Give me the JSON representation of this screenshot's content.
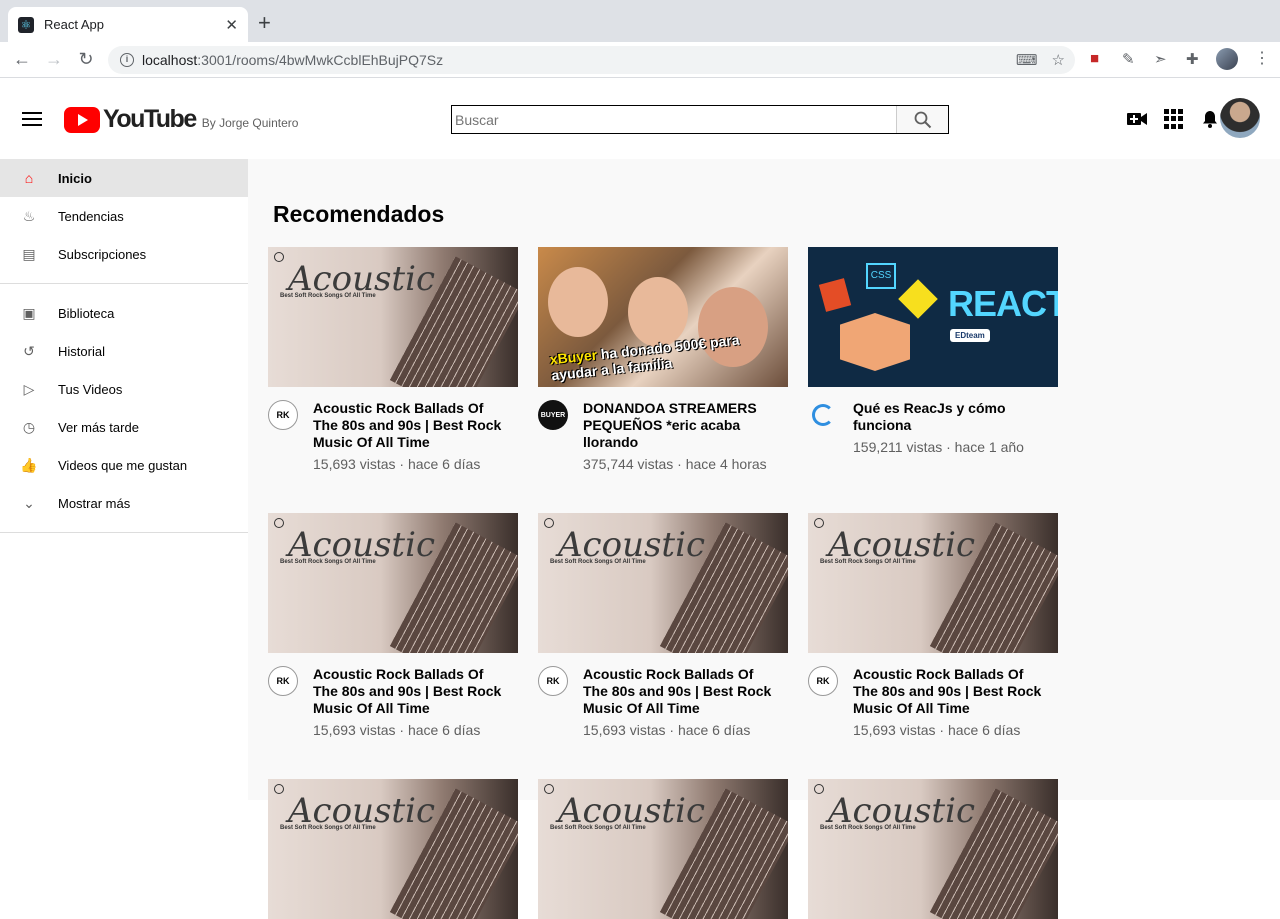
{
  "browser": {
    "tab_title": "React App",
    "tab_close": "✕",
    "new_tab": "+",
    "url_host": "localhost",
    "url_path": ":3001/rooms/4bwMwkCcblEhBujPQ7Sz"
  },
  "header": {
    "logo_word": "YouTube",
    "logo_by": "By Jorge Quintero",
    "search_placeholder": "Buscar"
  },
  "sidebar": {
    "primary": [
      {
        "label": "Inicio",
        "icon": "home-icon",
        "glyph": "⌂"
      },
      {
        "label": "Tendencias",
        "icon": "fire-icon",
        "glyph": "♨"
      },
      {
        "label": "Subscripciones",
        "icon": "subscriptions-icon",
        "glyph": "▤"
      }
    ],
    "secondary": [
      {
        "label": "Biblioteca",
        "icon": "library-icon",
        "glyph": "▣"
      },
      {
        "label": "Historial",
        "icon": "history-icon",
        "glyph": "↺"
      },
      {
        "label": "Tus Videos",
        "icon": "your-videos-icon",
        "glyph": "▷"
      },
      {
        "label": "Ver más tarde",
        "icon": "watch-later-icon",
        "glyph": "◷"
      },
      {
        "label": "Videos que me gustan",
        "icon": "like-icon",
        "glyph": "👍"
      },
      {
        "label": "Mostrar más",
        "icon": "chevron-down-icon",
        "glyph": "⌄"
      }
    ]
  },
  "main": {
    "section_title": "Recomendados",
    "videos": [
      {
        "title": "Acoustic Rock Ballads Of The 80s and 90s | Best Rock Music Of All Time",
        "meta": "15,693 vistas · hace 6 días",
        "thumb": "acoustic",
        "channel": "rock"
      },
      {
        "title": "DONANDOA STREAMERS PEQUEÑOS *eric acaba llorando",
        "meta": "375,744 vistas · hace 4 horas",
        "thumb": "buyer",
        "channel": "buyer"
      },
      {
        "title": "Qué es ReacJs y cómo funciona",
        "meta": "159,211 vistas · hace 1 año",
        "thumb": "react",
        "channel": "ed"
      },
      {
        "title": "Acoustic Rock Ballads Of The 80s and 90s | Best Rock Music Of All Time",
        "meta": "15,693 vistas · hace 6 días",
        "thumb": "acoustic",
        "channel": "rock"
      },
      {
        "title": "Acoustic Rock Ballads Of The 80s and 90s | Best Rock Music Of All Time",
        "meta": "15,693 vistas · hace 6 días",
        "thumb": "acoustic",
        "channel": "rock"
      },
      {
        "title": "Acoustic Rock Ballads Of The 80s and 90s | Best Rock Music Of All Time",
        "meta": "15,693 vistas · hace 6 días",
        "thumb": "acoustic",
        "channel": "rock"
      }
    ],
    "thumb_text": {
      "acoustic_title": "Acoustic",
      "acoustic_sub": "Best Soft Rock Songs Of All Time",
      "buyer_caption_a": "xBuyer",
      "buyer_caption_b": " ha donado 500€ para ayudar a la familia",
      "react_word": "REACT",
      "react_badge": "EDteam",
      "react_css": "CSS"
    },
    "channel_badges": {
      "buyer": "BUYER",
      "rock": "RK"
    }
  }
}
